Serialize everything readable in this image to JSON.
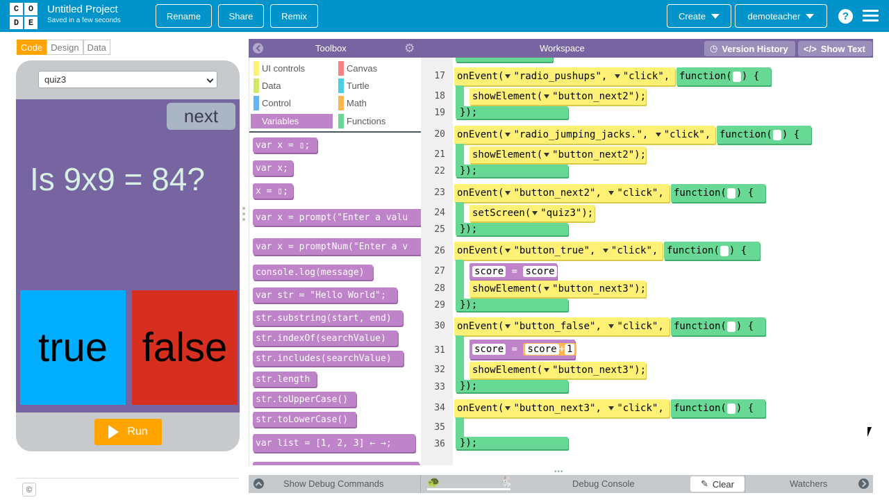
{
  "header": {
    "logo_letters": [
      "C",
      "O",
      "D",
      "E"
    ],
    "project_title": "Untitled Project",
    "project_status": "Saved in a few seconds",
    "buttons": {
      "rename": "Rename",
      "share": "Share",
      "remix": "Remix",
      "create": "Create",
      "user": "demoteacher"
    },
    "help_glyph": "?",
    "color": "#0094ca"
  },
  "modes": [
    "Code",
    "Design",
    "Data"
  ],
  "app": {
    "screen_select": "quiz3",
    "next_label": "next",
    "question": "Is 9x9 = 84?",
    "true_label": "true",
    "false_label": "false",
    "run_label": "Run",
    "copyright": "©",
    "screen_color": "#7665a0"
  },
  "toolbox": {
    "title": "Toolbox",
    "categories": [
      {
        "label": "UI controls",
        "color": "#fff176"
      },
      {
        "label": "Canvas",
        "color": "#f78183"
      },
      {
        "label": "Data",
        "color": "#d3e965"
      },
      {
        "label": "Turtle",
        "color": "#4dd0e1"
      },
      {
        "label": "Control",
        "color": "#64b5f6"
      },
      {
        "label": "Math",
        "color": "#ffb74d"
      },
      {
        "label": "Variables",
        "color": "#be83c8"
      },
      {
        "label": "Functions",
        "color": "#68d995"
      }
    ],
    "blocks": [
      "var x = ▯;",
      "var x;",
      "x = ▯;",
      "var x = prompt(\"Enter a valu",
      "var x = promptNum(\"Enter a v",
      "console.log(message)",
      "var str = \"Hello World\";",
      "str.substring(start, end)",
      "str.indexOf(searchValue)",
      "str.includes(searchValue)",
      "str.length",
      "str.toUpperCase()",
      "str.toLowerCase()",
      "var list = [1, 2, 3] ← →;"
    ]
  },
  "workspace": {
    "title": "Workspace",
    "version_history": "Version History",
    "show_text": "Show Text",
    "line_numbers": [
      "17",
      "18",
      "19",
      "20",
      "21",
      "22",
      "23",
      "24",
      "25",
      "26",
      "27",
      "28",
      "29",
      "30",
      "31",
      "32",
      "33",
      "34",
      "35",
      "36"
    ],
    "code": {
      "l17_event": "onEvent(",
      "l17_target": "\"radio_pushups\"",
      "l17_type": "\"click\"",
      "function_kw": "function(",
      "brace_open": ") {",
      "brace_close": "});",
      "l18_fn": "showElement(",
      "l18_arg": "\"button_next2\"",
      "close_paren": ");",
      "l20_target": "\"radio_jumping_jacks.\"",
      "l21_arg": "\"button_next2\"",
      "l23_target": "\"button_next2\"",
      "l24_fn": "setScreen(",
      "l24_arg": "\"quiz3\"",
      "l26_target": "\"button_true\"",
      "l27_var": "score",
      "l27_eq": "=",
      "l27_val": "score",
      "semicolon": ";",
      "l28_arg": "\"button_next3\"",
      "l30_target": "\"button_false\"",
      "l31_var": "score",
      "l31_val": "score",
      "l31_op": "+",
      "l31_num": "1",
      "l32_arg": "\"button_next3\"",
      "l34_target": "\"button_next3\"",
      "comma": ","
    }
  },
  "debug": {
    "show_debug": "Show Debug Commands",
    "console": "Debug Console",
    "clear": "Clear",
    "watchers": "Watchers"
  }
}
